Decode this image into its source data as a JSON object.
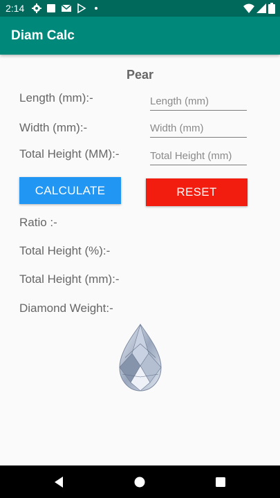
{
  "status_bar": {
    "time": "2:14",
    "left_icons": [
      "settings-icon",
      "square-notification-icon",
      "gmail-icon",
      "play-store-icon",
      "dot-icon"
    ],
    "right_icons": [
      "wifi-icon",
      "cellular-signal-icon",
      "battery-icon"
    ]
  },
  "app_bar": {
    "title": "Diam Calc",
    "color": "#00897b"
  },
  "heading": "Pear",
  "inputs": {
    "length_label": "Length (mm):-",
    "length_placeholder": "Length (mm)",
    "width_label": "Width (mm):-",
    "width_placeholder": "Width (mm)",
    "height_label": "Total Height (MM):-",
    "height_placeholder": "Total Height (mm)"
  },
  "buttons": {
    "calculate": "CALCULATE",
    "calculate_color": "#2196f3",
    "reset": "RESET",
    "reset_color": "#f21c0f"
  },
  "results": {
    "ratio_label": "Ratio :-",
    "height_pct_label": "Total Height (%):-",
    "height_mm_label": "Total Height (mm):-",
    "weight_label": "Diamond Weight:-"
  },
  "image": {
    "icon": "pear-diamond-icon"
  },
  "nav_bar": {
    "icons": [
      "back-icon",
      "home-icon",
      "recents-icon"
    ]
  }
}
